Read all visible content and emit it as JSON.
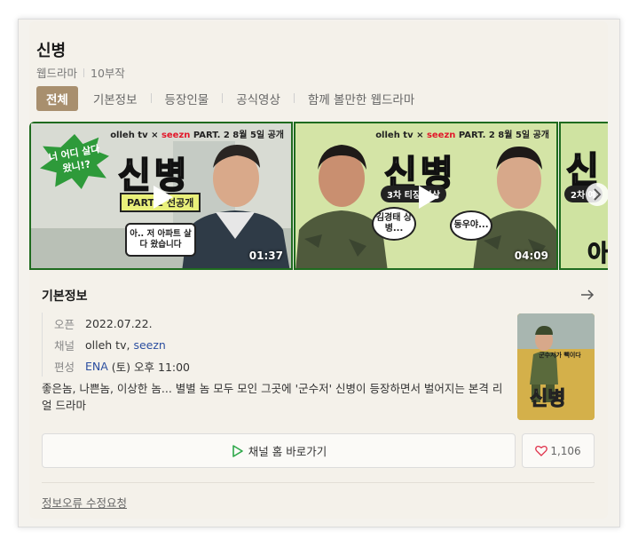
{
  "drama": {
    "title": "신병",
    "category": "웹드라마",
    "episodes": "10부작"
  },
  "tabs": [
    "전체",
    "기본정보",
    "등장인물",
    "공식영상",
    "함께 볼만한 웹드라마"
  ],
  "videos": [
    {
      "brand_prefix": "olleh tv × ",
      "brand_seezn": "seezn",
      "brand_suffix": " PART. 2 8월 5일 공개",
      "badge": "너 어디 살다 왔니!?",
      "big_title": "신병",
      "label": "PART.2 선공개",
      "speech": "아.. 저 아파트 살다 왔습니다",
      "duration": "01:37"
    },
    {
      "brand_prefix": "olleh tv × ",
      "brand_seezn": "seezn",
      "brand_suffix": " PART. 2 8월 5일 공개",
      "big_title": "신병",
      "pill": "3차 티징 영상",
      "speech_left": "김경태 상병...",
      "speech_right": "동우야...",
      "duration": "04:09"
    },
    {
      "big_title": "신",
      "pill": "2차 예",
      "bottom_text": "아"
    }
  ],
  "info": {
    "section_title": "기본정보",
    "rows": [
      {
        "key": "오픈",
        "value": "2022.07.22."
      },
      {
        "key": "채널",
        "value_a": "olleh tv",
        "value_sep": ", ",
        "value_b": "seezn"
      },
      {
        "key": "편성",
        "value_link": "ENA",
        "value_rest": " (토) 오후 11:00"
      }
    ],
    "description": "좋은놈, 나쁜놈, 이상한 놈... 별별 놈 모두 모인 그곳에 '군수저' 신병이 등장하면서 벌어지는 본격 리얼 드라마"
  },
  "poster": {
    "tagline": "군수저가 빽이다",
    "title": "신병"
  },
  "buttons": {
    "channel_home": "채널 홈 바로가기",
    "like_count": "1,106"
  },
  "report_link": "정보오류 수정요청",
  "colors": {
    "accent_tab": "#a88f6e",
    "thumb_border": "#1f6b1f",
    "link_blue": "#2c4fa0",
    "like_heart": "#e0304a",
    "channel_play": "#2ea84a"
  }
}
